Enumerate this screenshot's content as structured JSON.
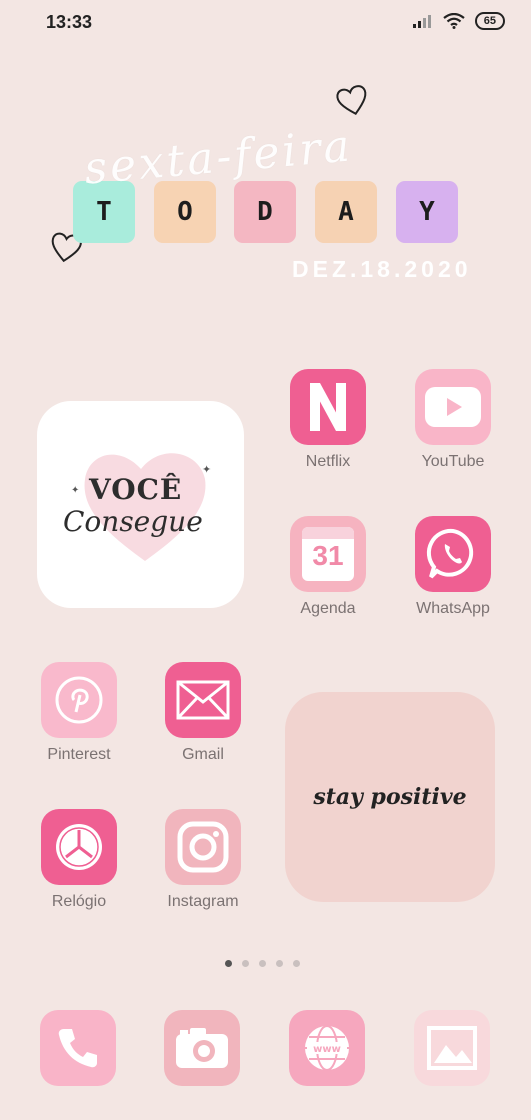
{
  "status_bar": {
    "time": "13:33",
    "battery": "65"
  },
  "today_widget": {
    "weekday_script": "sexta-feira",
    "letters": [
      "T",
      "O",
      "D",
      "A",
      "Y"
    ],
    "letter_colors": [
      "#a9ecdc",
      "#f7d3b3",
      "#f4b7c2",
      "#f6d2b3",
      "#d7b1ef"
    ],
    "date": "DEZ.18.2020"
  },
  "apps": {
    "netflix": "Netflix",
    "youtube": "YouTube",
    "agenda": "Agenda",
    "agenda_day": "31",
    "whatsapp": "WhatsApp",
    "pinterest": "Pinterest",
    "gmail": "Gmail",
    "relogio": "Relógio",
    "instagram": "Instagram"
  },
  "widgets": {
    "voce_line1": "VOCÊ",
    "voce_line2": "Consegue",
    "stay_positive": "stay positive"
  },
  "pages": {
    "count": 5,
    "active": 1
  },
  "colors": {
    "background": "#f3e6e3",
    "hot_pink": "#ef5f92",
    "soft_pink": "#f9b9cc",
    "dusty_pink": "#f1b5bd"
  }
}
